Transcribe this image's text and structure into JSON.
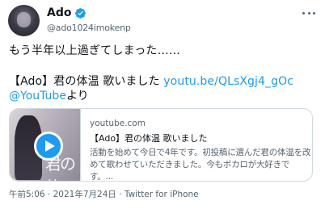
{
  "user": {
    "display_name": "Ado",
    "handle": "@ado1024imokenp",
    "verified": true
  },
  "tweet": {
    "line1": "もう半年以上過ぎてしまった……",
    "line2_prefix": "【Ado】君の体温 歌いました ",
    "link_url": "youtu.be/QLsXgj4_gOc",
    "mention": "@YouTube",
    "suffix": "より"
  },
  "card": {
    "domain": "youtube.com",
    "title": "【Ado】君の体温 歌いました",
    "description_line1": "活動を始めて今日で4年です。初投稿に選んだ君の体温を改",
    "description_line2": "めて歌わせていただきました。今もボカロが大好きです。..."
  },
  "meta": {
    "time": "午前5:06",
    "date": "2021年7月24日",
    "separator": " · ",
    "source": "Twitter for iPhone"
  },
  "colors": {
    "link": "#1d9bf0",
    "secondary_text": "#536471",
    "border": "#cfd9de"
  },
  "icons": {
    "verified": "verified-badge-icon",
    "more": "more-options-icon",
    "play": "play-icon"
  }
}
